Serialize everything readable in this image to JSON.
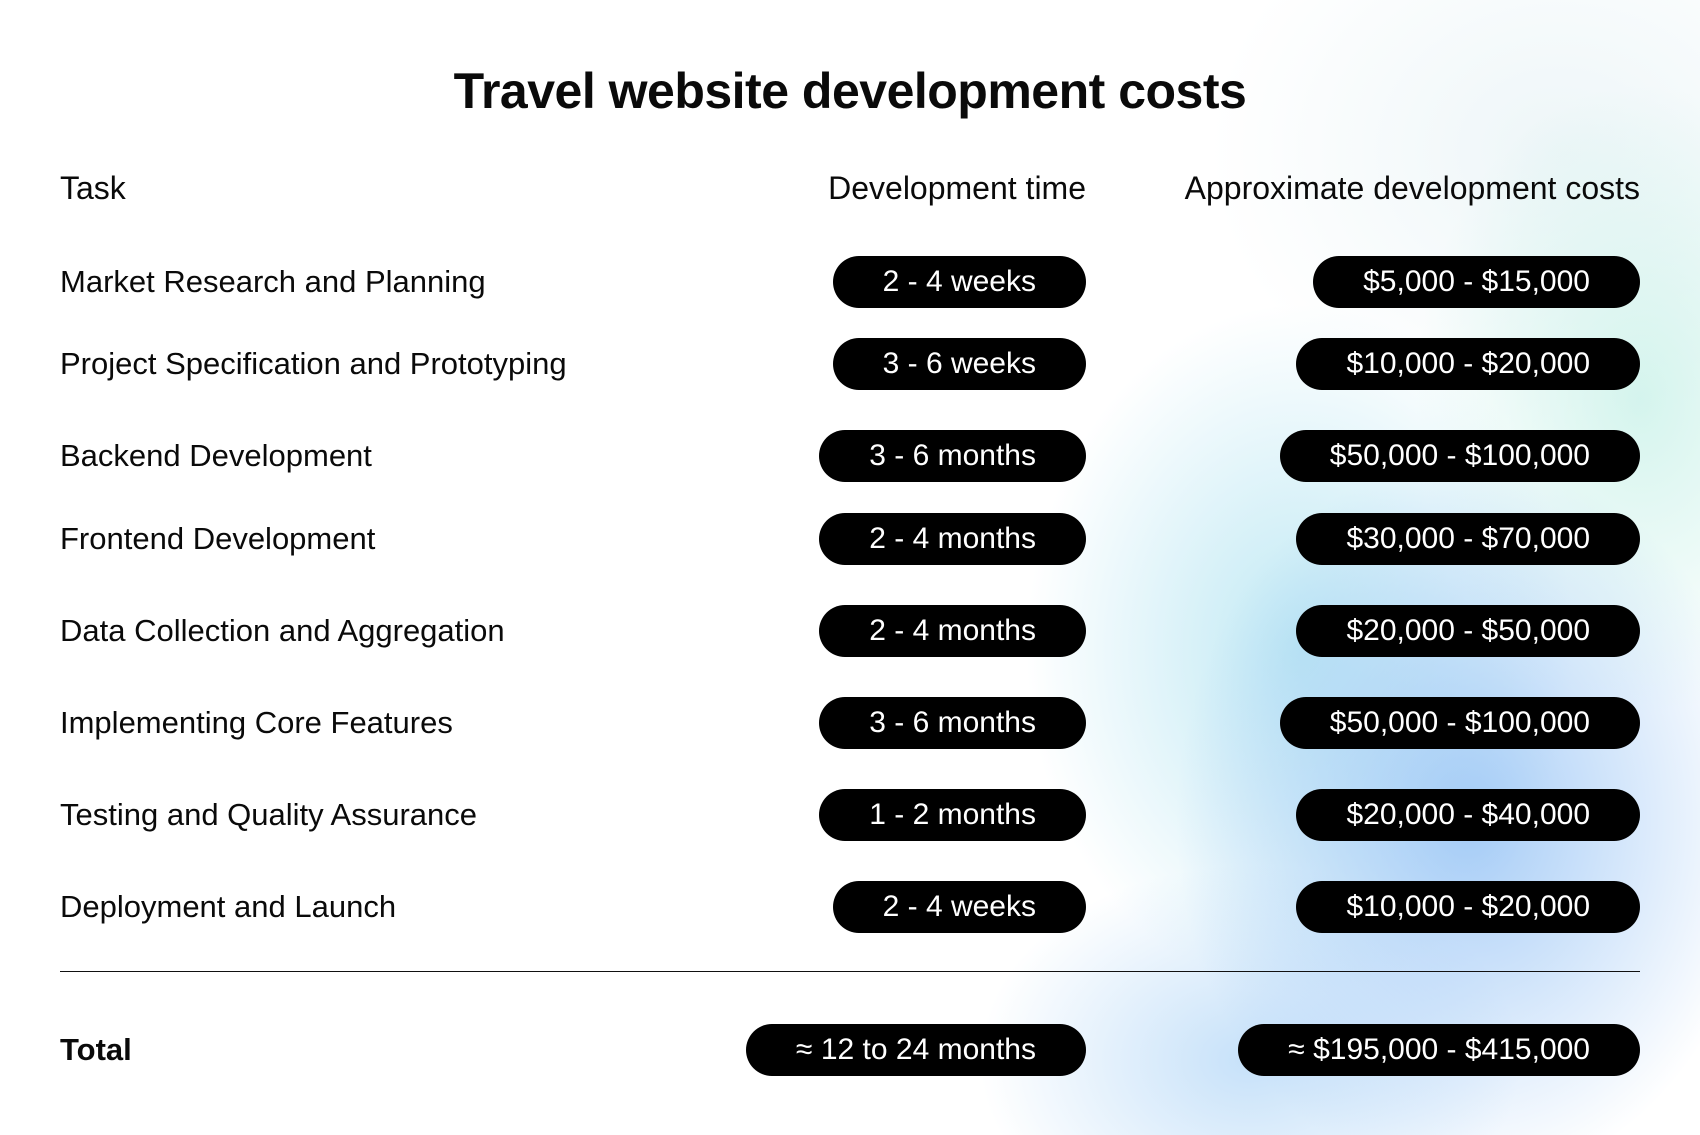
{
  "title": "Travel website development costs",
  "headers": {
    "task": "Task",
    "time": "Development time",
    "cost": "Approximate development costs"
  },
  "rows": [
    {
      "task": "Market Research and Planning",
      "time": "2 - 4 weeks",
      "cost": "$5,000 - $15,000"
    },
    {
      "task": "Project Specification and Prototyping",
      "time": "3 - 6 weeks",
      "cost": "$10,000 - $20,000"
    },
    {
      "task": "Backend Development",
      "time": "3 - 6 months",
      "cost": "$50,000 - $100,000"
    },
    {
      "task": "Frontend Development",
      "time": "2 - 4 months",
      "cost": "$30,000 - $70,000"
    },
    {
      "task": "Data Collection and Aggregation",
      "time": "2 - 4 months",
      "cost": "$20,000 - $50,000"
    },
    {
      "task": "Implementing Core Features",
      "time": "3 - 6 months",
      "cost": "$50,000 - $100,000"
    },
    {
      "task": "Testing and Quality Assurance",
      "time": "1 - 2 months",
      "cost": "$20,000 - $40,000"
    },
    {
      "task": "Deployment and Launch",
      "time": "2 - 4 weeks",
      "cost": "$10,000 - $20,000"
    }
  ],
  "total": {
    "label": "Total",
    "time": "≈ 12 to 24 months",
    "cost": "≈ $195,000 - $415,000"
  },
  "colors": {
    "pill_background": "#000000",
    "pill_text": "#ffffff",
    "accent_gradient_blue": "#96c3f5",
    "accent_gradient_cyan": "#aae1f0"
  }
}
